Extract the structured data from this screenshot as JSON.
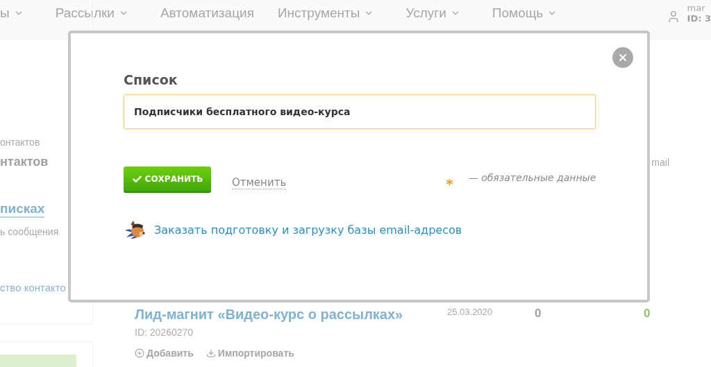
{
  "nav": {
    "items": [
      {
        "label": "ы",
        "dropdown": true
      },
      {
        "label": "Рассылки",
        "dropdown": true
      },
      {
        "label": "Автоматизация",
        "dropdown": false
      },
      {
        "label": "Инструменты",
        "dropdown": true
      },
      {
        "label": "Услуги",
        "dropdown": true
      },
      {
        "label": "Помощь",
        "dropdown": true
      }
    ],
    "user": {
      "name": "mar",
      "id": "ID: 3"
    }
  },
  "sidebar": {
    "caption": "онтактов",
    "heading": "нтактов",
    "link": "писках",
    "note": "ь сообщения",
    "link_2": "ство контакто"
  },
  "table": {
    "column_email": "mail",
    "row": {
      "title": "Лид-магнит «Видео-курс о рассылках»",
      "id": "ID: 20260270",
      "date": "25.03.2020",
      "count_1": "0",
      "count_2": "0",
      "actions": [
        "Добавить",
        "Импортировать"
      ]
    }
  },
  "dialog": {
    "label": "Список",
    "value": "Подписчики бесплатного видео-курса",
    "focused": true,
    "save": "СОХРАНИТЬ",
    "cancel": "Отменить",
    "required_mark": "*",
    "required_note": "— обязательные данные",
    "order_link": "Заказать подготовку и загрузку базы email-адресов"
  }
}
